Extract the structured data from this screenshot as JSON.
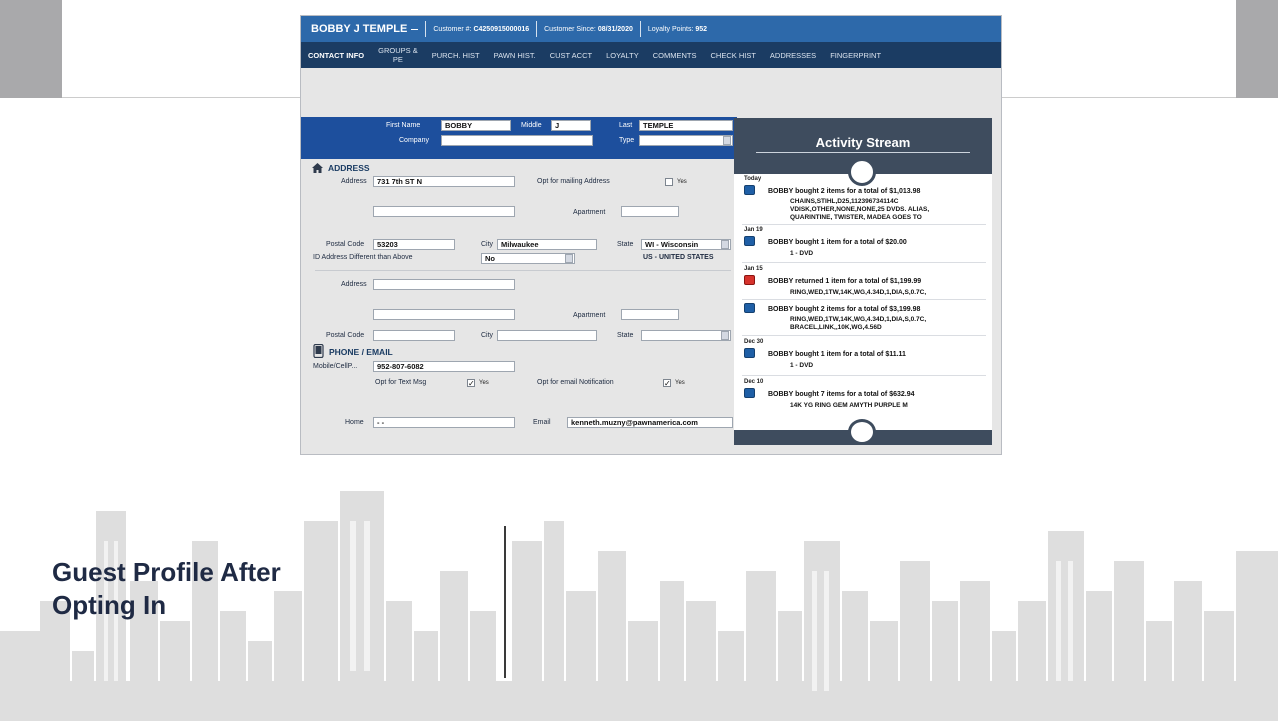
{
  "slide": {
    "title_line1": "Guest Profile After",
    "title_line2": "Opting In"
  },
  "header": {
    "customer_name": "BOBBY J TEMPLE",
    "customer_no_label": "Customer #:",
    "customer_no": "C4250915000016",
    "since_label": "Customer Since:",
    "since": "08/31/2020",
    "points_label": "Loyalty Points:",
    "points": "952"
  },
  "tabs": [
    {
      "label": "CONTACT INFO",
      "active": true
    },
    {
      "label": "GROUPS &\nPE",
      "active": false
    },
    {
      "label": "PURCH. HIST",
      "active": false
    },
    {
      "label": "PAWN HIST.",
      "active": false
    },
    {
      "label": "CUST ACCT",
      "active": false
    },
    {
      "label": "LOYALTY",
      "active": false
    },
    {
      "label": "COMMENTS",
      "active": false
    },
    {
      "label": "CHECK HIST",
      "active": false
    },
    {
      "label": "ADDRESSES",
      "active": false
    },
    {
      "label": "FINGERPRINT",
      "active": false
    }
  ],
  "name_band": {
    "first_label": "First Name",
    "first": "BOBBY",
    "middle_label": "Middle",
    "middle": "J",
    "last_label": "Last",
    "last": "TEMPLE",
    "company_label": "Company",
    "company": "",
    "type_label": "Type",
    "type": ""
  },
  "address": {
    "heading": "ADDRESS",
    "address_label": "Address",
    "address": "731 7th ST N",
    "opt_mailing_label": "Opt for mailing Address",
    "opt_mailing_yes": "Yes",
    "apartment_label": "Apartment",
    "apartment": "",
    "postal_label": "Postal Code",
    "postal": "53203",
    "city_label": "City",
    "city": "Milwaukee",
    "state_label": "State",
    "state": "WI - Wisconsin",
    "id_diff_label": "ID Address Different than Above",
    "id_diff": "No",
    "country": "US - UNITED STATES",
    "address2_label": "Address",
    "address2": "",
    "apartment2_label": "Apartment",
    "postal2_label": "Postal Code",
    "city2_label": "City",
    "state2_label": "State"
  },
  "phone": {
    "heading": "PHONE / EMAIL",
    "mobile_label": "Mobile/CellP...",
    "mobile": "952-807-6082",
    "opt_text_label": "Opt for Text Msg",
    "opt_text_yes": "Yes",
    "opt_text_checked": true,
    "opt_email_label": "Opt for email Notification",
    "opt_email_yes": "Yes",
    "opt_email_checked": true,
    "home_label": "Home",
    "home": "- -",
    "email_label": "Email",
    "email": "kenneth.muzny@pawnamerica.com"
  },
  "activity": {
    "title": "Activity Stream",
    "groups": [
      {
        "date": "Today",
        "items": [
          {
            "kind": "purchase",
            "text": "BOBBY bought 2 items for a total of $1,013.98",
            "detail": "CHAINS,STIHL,D25,112396734114C\nVDISK,OTHER,NONE,NONE,25 DVDS. ALIAS,\nQUARINTINE, TWISTER, MADEA GOES TO"
          }
        ]
      },
      {
        "date": "Jan 19",
        "items": [
          {
            "kind": "purchase",
            "text": "BOBBY bought 1 item for a total of $20.00",
            "detail": "1 - DVD"
          }
        ]
      },
      {
        "date": "Jan 15",
        "items": [
          {
            "kind": "return",
            "text": "BOBBY returned 1 item for a total of $1,199.99",
            "detail": "RING,WED,1TW,14K,WG,4.34D,1,DIA,S,0.7C,"
          },
          {
            "kind": "purchase",
            "text": "BOBBY bought 2 items for a total of $3,199.98",
            "detail": "RING,WED,1TW,14K,WG,4.34D,1,DIA,S,0.7C,\nBRACEL,LINK,,10K,WG,4.56D"
          }
        ]
      },
      {
        "date": "Dec 30",
        "items": [
          {
            "kind": "purchase",
            "text": "BOBBY bought 1 item for a total of $11.11",
            "detail": "1 - DVD"
          }
        ]
      },
      {
        "date": "Dec 10",
        "items": [
          {
            "kind": "purchase",
            "text": "BOBBY bought 7 items for a total of $632.94",
            "detail": "14K YG RING GEM AMYTH PURPLE M"
          }
        ]
      }
    ]
  },
  "colors": {
    "header_blue": "#2d69aa",
    "tab_navy": "#1b3c63",
    "name_band_blue": "#1d4f9d",
    "activity_slate": "#3e4c5e",
    "return_red": "#d6322c",
    "title_text": "#1f2a44"
  }
}
